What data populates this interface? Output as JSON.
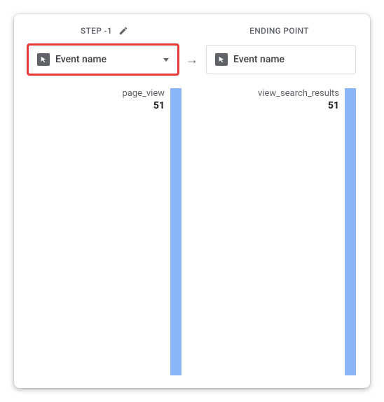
{
  "colors": {
    "highlight_border": "#e53935",
    "bar_fill": "#8ab4f8"
  },
  "header": {
    "step_label": "STEP -1",
    "ending_label": "ENDING POINT"
  },
  "selectors": {
    "left": {
      "label": "Event name"
    },
    "right": {
      "label": "Event name"
    }
  },
  "columns": {
    "left": {
      "event": "page_view",
      "value": "51"
    },
    "right": {
      "event": "view_search_results",
      "value": "51"
    }
  },
  "chart_data": {
    "type": "bar",
    "title": "",
    "categories": [
      "page_view",
      "view_search_results"
    ],
    "values": [
      51,
      51
    ],
    "xlabel": "",
    "ylabel": "",
    "ylim": [
      0,
      51
    ]
  }
}
